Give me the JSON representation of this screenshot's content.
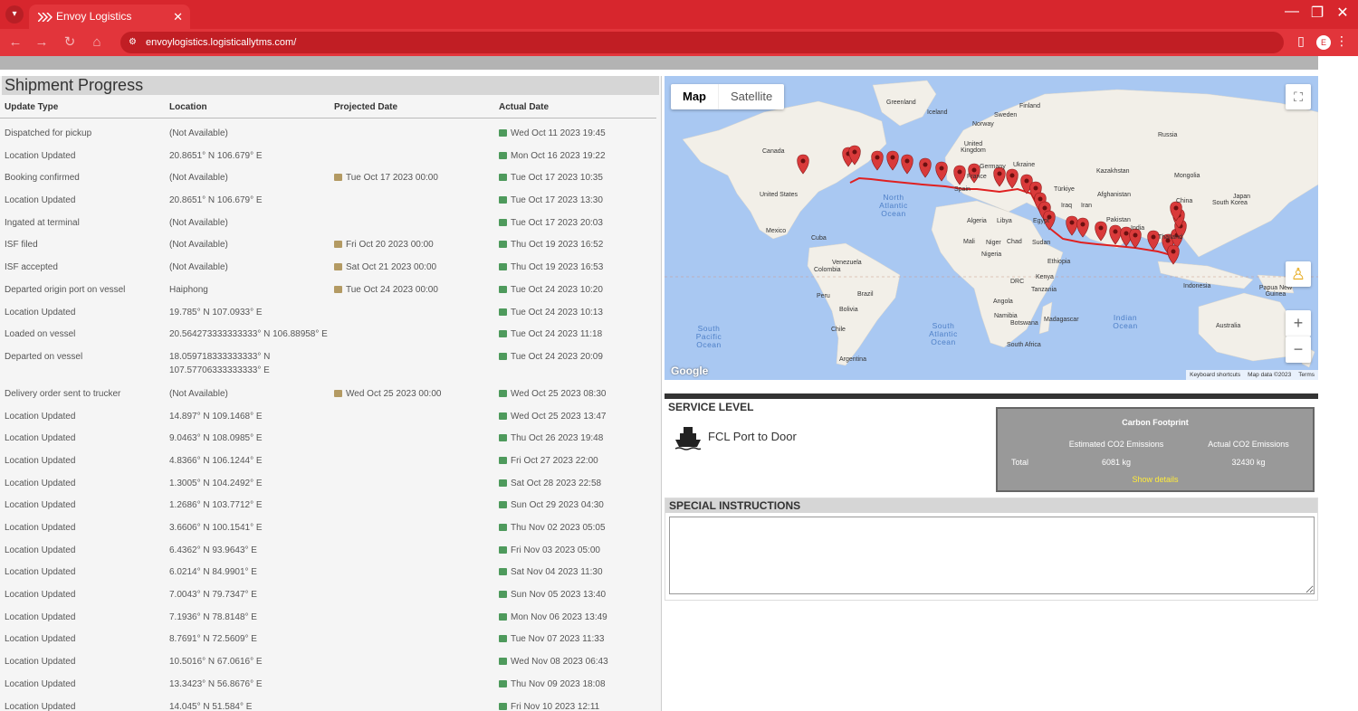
{
  "browser": {
    "tab_title": "Envoy Logistics",
    "url": "envoylogistics.logisticallytms.com/",
    "profile_initial": "E",
    "accent": "#d7262d"
  },
  "progress": {
    "title": "Shipment Progress",
    "headers": [
      "Update Type",
      "Location",
      "Projected Date",
      "Actual Date"
    ],
    "rows": [
      {
        "type": "Dispatched for pickup",
        "loc": "(Not Available)",
        "proj": "",
        "act": "Wed Oct 11 2023 19:45"
      },
      {
        "type": "Location Updated",
        "loc": "20.8651° N 106.679° E",
        "proj": "",
        "act": "Mon Oct 16 2023 19:22"
      },
      {
        "type": "Booking confirmed",
        "loc": "(Not Available)",
        "proj": "Tue Oct 17 2023 00:00",
        "act": "Tue Oct 17 2023 10:35"
      },
      {
        "type": "Location Updated",
        "loc": "20.8651° N 106.679° E",
        "proj": "",
        "act": "Tue Oct 17 2023 13:30"
      },
      {
        "type": "Ingated at terminal",
        "loc": "(Not Available)",
        "proj": "",
        "act": "Tue Oct 17 2023 20:03"
      },
      {
        "type": "ISF filed",
        "loc": "(Not Available)",
        "proj": "Fri Oct 20 2023 00:00",
        "act": "Thu Oct 19 2023 16:52"
      },
      {
        "type": "ISF accepted",
        "loc": "(Not Available)",
        "proj": "Sat Oct 21 2023 00:00",
        "act": "Thu Oct 19 2023 16:53"
      },
      {
        "type": "Departed origin port on vessel",
        "loc": "Haiphong",
        "proj": "Tue Oct 24 2023 00:00",
        "act": "Tue Oct 24 2023 10:20"
      },
      {
        "type": "Location Updated",
        "loc": "19.785° N 107.0933° E",
        "proj": "",
        "act": "Tue Oct 24 2023 10:13"
      },
      {
        "type": "Loaded on vessel",
        "loc": "20.564273333333333° N 106.88958° E",
        "proj": "",
        "act": "Tue Oct 24 2023 11:18"
      },
      {
        "type": "Departed on vessel",
        "loc": "18.059718333333333° N 107.57706333333333° E",
        "proj": "",
        "act": "Tue Oct 24 2023 20:09",
        "tall": true
      },
      {
        "type": "Delivery order sent to trucker",
        "loc": "(Not Available)",
        "proj": "Wed Oct 25 2023 00:00",
        "act": "Wed Oct 25 2023 08:30"
      },
      {
        "type": "Location Updated",
        "loc": "14.897° N 109.1468° E",
        "proj": "",
        "act": "Wed Oct 25 2023 13:47"
      },
      {
        "type": "Location Updated",
        "loc": "9.0463° N 108.0985° E",
        "proj": "",
        "act": "Thu Oct 26 2023 19:48"
      },
      {
        "type": "Location Updated",
        "loc": "4.8366° N 106.1244° E",
        "proj": "",
        "act": "Fri Oct 27 2023 22:00"
      },
      {
        "type": "Location Updated",
        "loc": "1.3005° N 104.2492° E",
        "proj": "",
        "act": "Sat Oct 28 2023 22:58"
      },
      {
        "type": "Location Updated",
        "loc": "1.2686° N 103.7712° E",
        "proj": "",
        "act": "Sun Oct 29 2023 04:30"
      },
      {
        "type": "Location Updated",
        "loc": "3.6606° N 100.1541° E",
        "proj": "",
        "act": "Thu Nov 02 2023 05:05"
      },
      {
        "type": "Location Updated",
        "loc": "6.4362° N 93.9643° E",
        "proj": "",
        "act": "Fri Nov 03 2023 05:00"
      },
      {
        "type": "Location Updated",
        "loc": "6.0214° N 84.9901° E",
        "proj": "",
        "act": "Sat Nov 04 2023 11:30"
      },
      {
        "type": "Location Updated",
        "loc": "7.0043° N 79.7347° E",
        "proj": "",
        "act": "Sun Nov 05 2023 13:40"
      },
      {
        "type": "Location Updated",
        "loc": "7.1936° N 78.8148° E",
        "proj": "",
        "act": "Mon Nov 06 2023 13:49"
      },
      {
        "type": "Location Updated",
        "loc": "8.7691° N 72.5609° E",
        "proj": "",
        "act": "Tue Nov 07 2023 11:33"
      },
      {
        "type": "Location Updated",
        "loc": "10.5016° N 67.0616° E",
        "proj": "",
        "act": "Wed Nov 08 2023 06:43"
      },
      {
        "type": "Location Updated",
        "loc": "13.3423° N 56.8676° E",
        "proj": "",
        "act": "Thu Nov 09 2023 18:08"
      },
      {
        "type": "Location Updated",
        "loc": "14.045° N 51.584° E",
        "proj": "",
        "act": "Fri Nov 10 2023 12:11"
      }
    ]
  },
  "map": {
    "tab_map": "Map",
    "tab_satellite": "Satellite",
    "zoom_in": "+",
    "zoom_out": "−",
    "logo": "Google",
    "attribution": [
      "Keyboard shortcuts",
      "Map data ©2023",
      "Terms"
    ],
    "labels": [
      "Canada",
      "United States",
      "Mexico",
      "Cuba",
      "Venezuela",
      "Colombia",
      "Peru",
      "Brazil",
      "Bolivia",
      "Chile",
      "Argentina",
      "Greenland",
      "Iceland",
      "Sweden",
      "Finland",
      "Norway",
      "United Kingdom",
      "Germany",
      "Ukraine",
      "France",
      "Spain",
      "Algeria",
      "Libya",
      "Egypt",
      "Mali",
      "Niger",
      "Chad",
      "Sudan",
      "Nigeria",
      "Ethiopia",
      "Kenya",
      "DRC",
      "Tanzania",
      "Angola",
      "Namibia",
      "Botswana",
      "South Africa",
      "Madagascar",
      "Türkiye",
      "Iraq",
      "Iran",
      "Afghanistan",
      "Pakistan",
      "India",
      "Kazakhstan",
      "Mongolia",
      "China",
      "Japan",
      "South Korea",
      "Thailand",
      "Indonesia",
      "Papua New Guinea",
      "Australia",
      "Russia"
    ],
    "oceans": [
      "North Atlantic Ocean",
      "South Atlantic Ocean",
      "South Pacific Ocean",
      "Indian Ocean"
    ],
    "marker_color": "#d93a3a"
  },
  "service": {
    "title": "SERVICE LEVEL",
    "level": "FCL Port to Door"
  },
  "carbon": {
    "title": "Carbon Footprint",
    "col_estimated": "Estimated CO2 Emissions",
    "col_actual": "Actual CO2 Emissions",
    "row_label": "Total",
    "estimated": "6081 kg",
    "actual": "32430 kg",
    "details_link": "Show details"
  },
  "special": {
    "title": "SPECIAL INSTRUCTIONS",
    "value": ""
  }
}
